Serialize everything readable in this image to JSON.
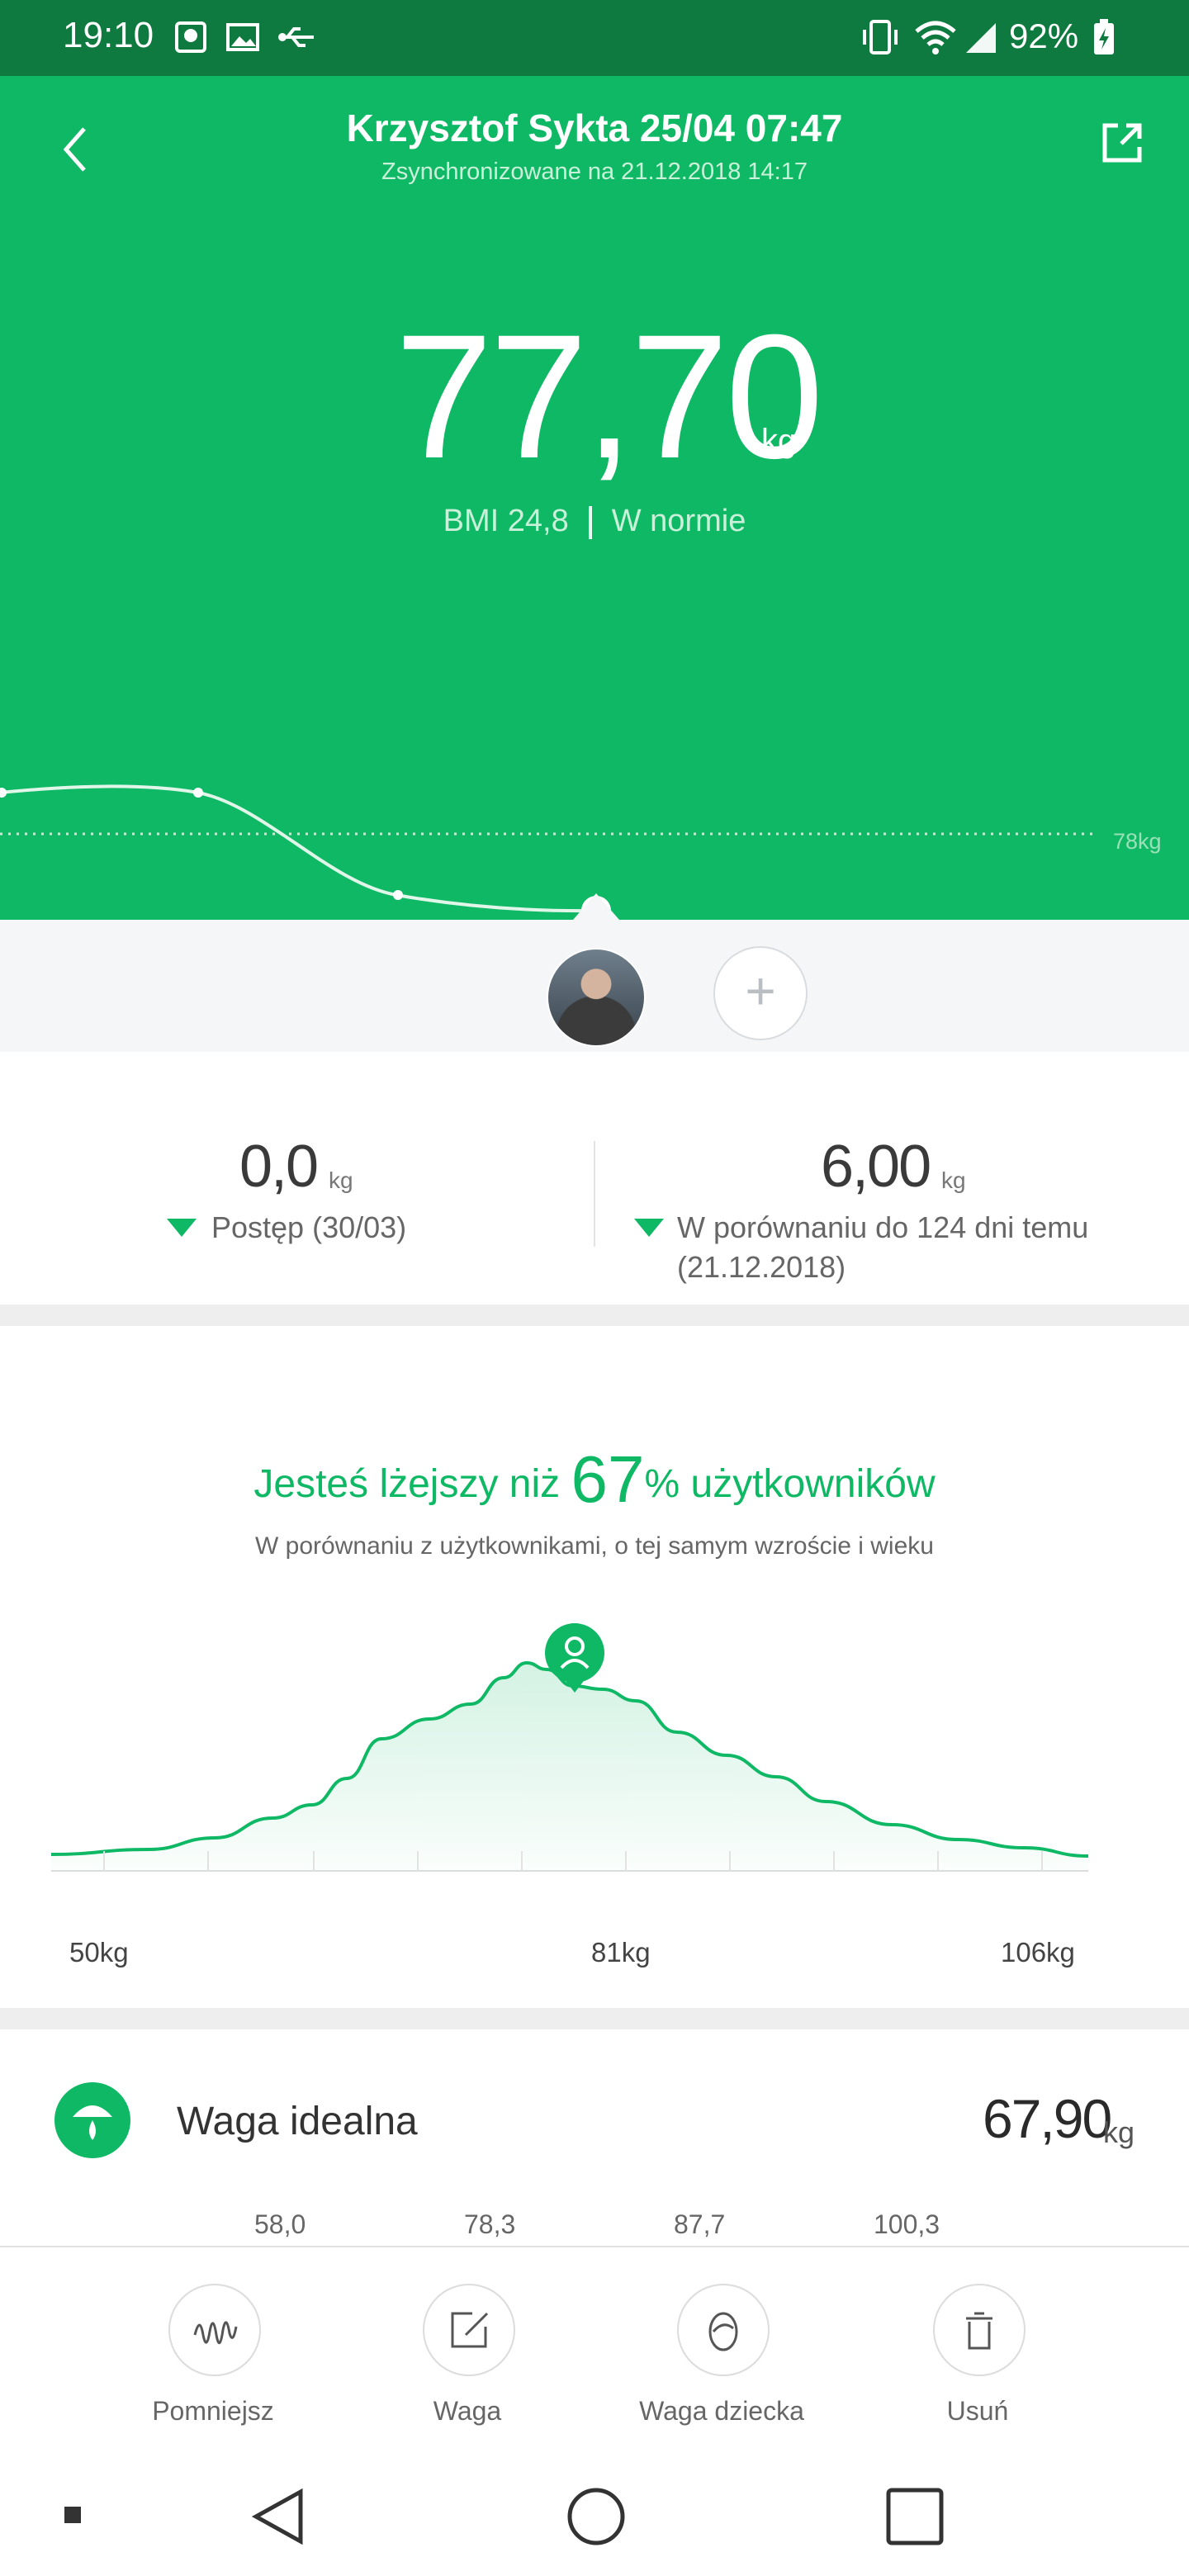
{
  "status_bar": {
    "time": "19:10",
    "battery_percent": "92%",
    "icons": [
      "app-notification-icon",
      "image-icon",
      "usb-icon",
      "vibrate-icon",
      "wifi-icon",
      "signal-icon",
      "battery-charging-icon"
    ]
  },
  "header": {
    "title": "Krzysztof Sykta 25/04 07:47",
    "subtitle": "Zsynchronizowane na 21.12.2018 14:17",
    "back_icon": "back-chevron-icon",
    "share_icon": "share-icon"
  },
  "weight": {
    "value": "77,70",
    "unit": "kg",
    "bmi": "BMI 24,8",
    "status": "W normie"
  },
  "trend_chart": {
    "reference_label": "78kg"
  },
  "profiles": {
    "add_icon": "plus-icon"
  },
  "progress": {
    "left": {
      "value": "0,0",
      "unit": "kg",
      "label": "Postęp (30/03)"
    },
    "right": {
      "value": "6,00",
      "unit": "kg",
      "label_line1": "W porównaniu do 124 dni temu",
      "label_line2": "(21.12.2018)"
    }
  },
  "comparison": {
    "title_prefix": "Jesteś lżejszy niż ",
    "percent": "67",
    "title_suffix": "% użytkowników",
    "subtitle": "W porównaniu z użytkownikami, o tej samym wzroście i wieku",
    "axis_labels": [
      "50kg",
      "81kg",
      "106kg"
    ],
    "marker_icon": "user-pin-icon"
  },
  "ideal_weight": {
    "label": "Waga idealna",
    "value": "67,90",
    "unit": "kg",
    "scale": [
      "58,0",
      "78,3",
      "87,7",
      "100,3"
    ],
    "icon": "scale-drop-icon"
  },
  "actions": [
    {
      "label": "Pomniejsz",
      "icon": "wave-icon"
    },
    {
      "label": "Waga",
      "icon": "edit-icon"
    },
    {
      "label": "Waga dziecka",
      "icon": "baby-icon"
    },
    {
      "label": "Usuń",
      "icon": "trash-icon"
    }
  ],
  "nav_bar": {
    "icons": [
      "recent-dot-icon",
      "back-triangle-icon",
      "home-circle-icon",
      "overview-square-icon"
    ]
  },
  "colors": {
    "primary_green": "#0fb865",
    "status_bar": "#0f7a3f"
  }
}
